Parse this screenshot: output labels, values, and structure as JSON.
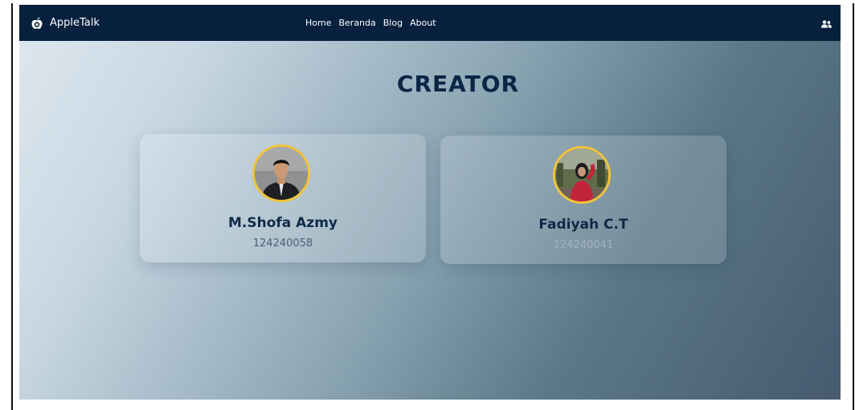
{
  "navbar": {
    "brand": "AppleTalk",
    "links": [
      {
        "label": "Home"
      },
      {
        "label": "Beranda"
      },
      {
        "label": "Blog"
      },
      {
        "label": "About"
      }
    ],
    "right_icon": "users-icon"
  },
  "page": {
    "title": "CREATOR"
  },
  "creators": [
    {
      "name": "M.Shofa Azmy",
      "id": "124240058",
      "avatar_icon": "profile-photo"
    },
    {
      "name": "Fadiyah C.T",
      "id": "124240041",
      "avatar_icon": "profile-photo"
    }
  ],
  "colors": {
    "navbar_bg": "#06203e",
    "title": "#0b2645",
    "avatar_border": "#f1c33c",
    "card_name": "#0f2a48"
  }
}
